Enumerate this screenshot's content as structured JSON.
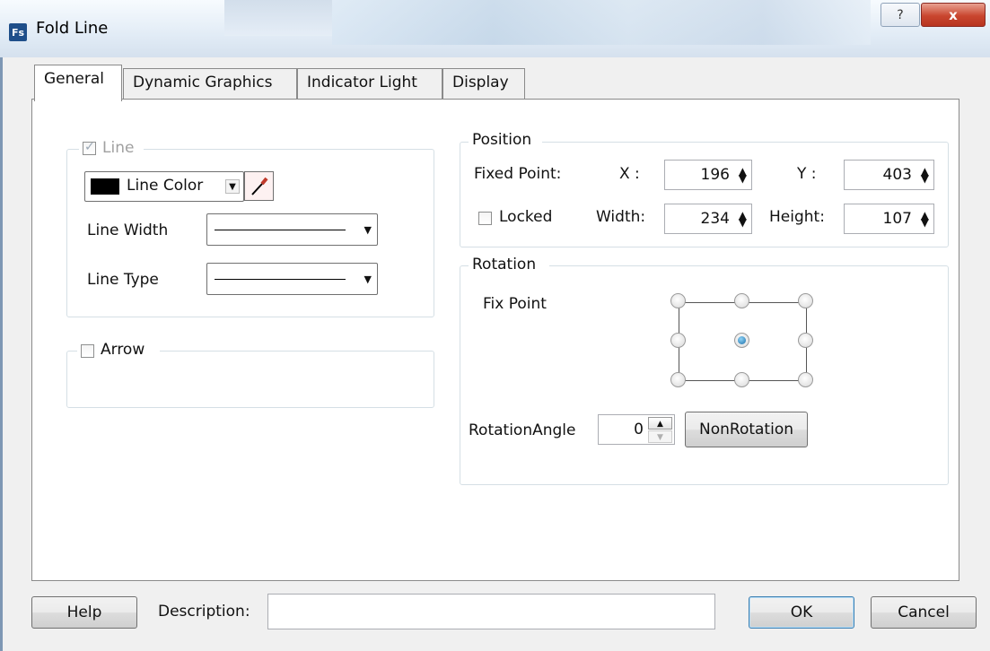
{
  "window": {
    "title": "Fold Line",
    "app_icon": "Fs",
    "help_glyph": "?",
    "close_glyph": "x"
  },
  "tabs": [
    {
      "label": "General",
      "active": true
    },
    {
      "label": "Dynamic Graphics",
      "active": false
    },
    {
      "label": "Indicator Light",
      "active": false
    },
    {
      "label": "Display",
      "active": false
    }
  ],
  "line_group": {
    "title": "Line",
    "enabled_checked": true,
    "color_label": "Line Color",
    "width_label": "Line Width",
    "type_label": "Line Type"
  },
  "arrow_group": {
    "title": "Arrow",
    "checked": false
  },
  "position_group": {
    "title": "Position",
    "fixed_point_label": "Fixed Point:",
    "x_label": "X :",
    "x_value": "196",
    "y_label": "Y :",
    "y_value": "403",
    "locked_label": "Locked",
    "locked_checked": false,
    "width_label": "Width:",
    "width_value": "234",
    "height_label": "Height:",
    "height_value": "107"
  },
  "rotation_group": {
    "title": "Rotation",
    "fix_point_label": "Fix Point",
    "selected_point": "center",
    "angle_label": "RotationAngle",
    "angle_value": "0",
    "non_rotation_label": "NonRotation"
  },
  "footer": {
    "help_label": "Help",
    "description_label": "Description:",
    "description_value": "",
    "ok_label": "OK",
    "cancel_label": "Cancel"
  },
  "colors": {
    "line_color": "#000000",
    "radio_selected": "#1c6fa8"
  }
}
